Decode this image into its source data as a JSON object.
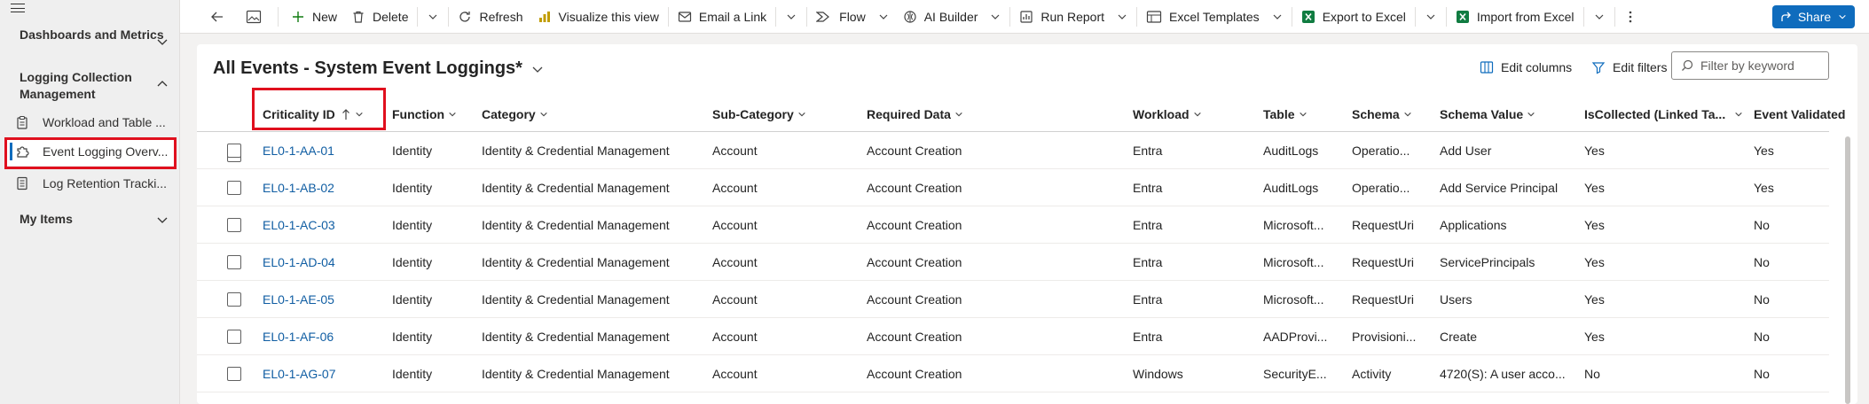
{
  "sidebar": {
    "groups": [
      {
        "label": "Dashboards and Metrics"
      },
      {
        "label": "Logging Collection Management"
      },
      {
        "label": "My Items"
      }
    ],
    "items": [
      {
        "label": "Workload and Table ..."
      },
      {
        "label": "Event Logging Overv..."
      },
      {
        "label": "Log Retention Tracki..."
      }
    ]
  },
  "toolbar": {
    "new": "New",
    "delete": "Delete",
    "refresh": "Refresh",
    "visualize": "Visualize this view",
    "email": "Email a Link",
    "flow": "Flow",
    "ai_builder": "AI Builder",
    "run_report": "Run Report",
    "excel_templates": "Excel Templates",
    "export_excel": "Export to Excel",
    "import_excel": "Import from Excel",
    "share": "Share"
  },
  "view": {
    "title": "All Events - System Event Loggings*",
    "edit_columns": "Edit columns",
    "edit_filters": "Edit filters",
    "filter_placeholder": "Filter by keyword"
  },
  "columns": [
    "Criticality ID",
    "Function",
    "Category",
    "Sub-Category",
    "Required Data",
    "Workload",
    "Table",
    "Schema",
    "Schema Value",
    "IsCollected (Linked Ta...",
    "Event Validated"
  ],
  "rows": [
    [
      "EL0-1-AA-01",
      "Identity",
      "Identity & Credential Management",
      "Account",
      "Account Creation",
      "Entra",
      "AuditLogs",
      "Operatio...",
      "Add User",
      "Yes",
      "Yes"
    ],
    [
      "EL0-1-AB-02",
      "Identity",
      "Identity & Credential Management",
      "Account",
      "Account Creation",
      "Entra",
      "AuditLogs",
      "Operatio...",
      "Add Service Principal",
      "Yes",
      "Yes"
    ],
    [
      "EL0-1-AC-03",
      "Identity",
      "Identity & Credential Management",
      "Account",
      "Account Creation",
      "Entra",
      "Microsoft...",
      "RequestUri",
      "Applications",
      "Yes",
      "No"
    ],
    [
      "EL0-1-AD-04",
      "Identity",
      "Identity & Credential Management",
      "Account",
      "Account Creation",
      "Entra",
      "Microsoft...",
      "RequestUri",
      "ServicePrincipals",
      "Yes",
      "No"
    ],
    [
      "EL0-1-AE-05",
      "Identity",
      "Identity & Credential Management",
      "Account",
      "Account Creation",
      "Entra",
      "Microsoft...",
      "RequestUri",
      "Users",
      "Yes",
      "No"
    ],
    [
      "EL0-1-AF-06",
      "Identity",
      "Identity & Credential Management",
      "Account",
      "Account Creation",
      "Entra",
      "AADProvi...",
      "Provisioni...",
      "Create",
      "Yes",
      "No"
    ],
    [
      "EL0-1-AG-07",
      "Identity",
      "Identity & Credential Management",
      "Account",
      "Account Creation",
      "Windows",
      "SecurityE...",
      "Activity",
      "4720(S): A user acco...",
      "No",
      "No"
    ]
  ],
  "colors": {
    "accent": "#0f6cbd",
    "highlight": "#e0101e",
    "link": "#115ea3"
  }
}
